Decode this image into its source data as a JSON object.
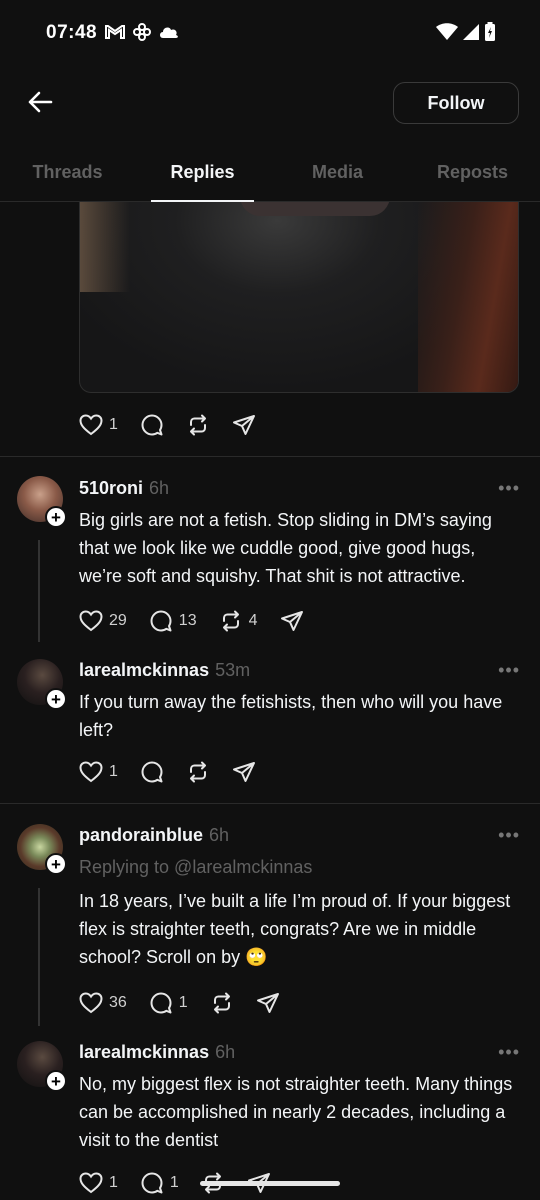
{
  "status_bar": {
    "time": "07:48"
  },
  "header": {
    "follow_label": "Follow"
  },
  "tabs": [
    {
      "label": "Threads",
      "active": false
    },
    {
      "label": "Replies",
      "active": true
    },
    {
      "label": "Media",
      "active": false
    },
    {
      "label": "Reposts",
      "active": false
    }
  ],
  "top_post": {
    "likes": "1"
  },
  "posts": [
    {
      "username": "510roni",
      "time": "6h",
      "text": "Big girls are not a fetish. Stop sliding in DM’s saying that we look like we cuddle good, give good hugs, we’re soft and squishy. That shit is not attractive.",
      "likes": "29",
      "replies": "13",
      "reposts": "4"
    },
    {
      "username": "larealmckinnas",
      "time": "53m",
      "text": "If you turn away the fetishists, then who will you have left?",
      "likes": "1",
      "replies": "",
      "reposts": ""
    },
    {
      "username": "pandorainblue",
      "time": "6h",
      "replying_to": "Replying to @larealmckinnas",
      "text": "In 18 years, I’ve built a life I’m proud of. If your biggest flex is straighter teeth, congrats? Are we in middle school? Scroll on by 🙄",
      "likes": "36",
      "replies": "1",
      "reposts": ""
    },
    {
      "username": "larealmckinnas",
      "time": "6h",
      "text": "No, my biggest flex is not straighter teeth. Many things can be accomplished in nearly 2 decades, including a visit to the dentist",
      "likes": "1",
      "replies": "1",
      "reposts": ""
    }
  ],
  "more_label": "•••",
  "icons": [
    "back-arrow-icon",
    "heart-icon",
    "comment-icon",
    "repost-icon",
    "share-icon",
    "wifi-icon",
    "signal-icon",
    "battery-icon",
    "gmail-icon",
    "pinwheel-icon",
    "cloud-icon",
    "plus-icon"
  ]
}
